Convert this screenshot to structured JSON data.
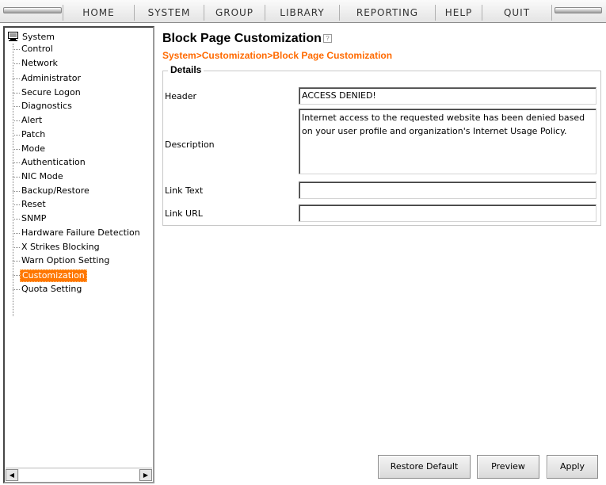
{
  "menu": {
    "items": [
      "HOME",
      "SYSTEM",
      "GROUP",
      "LIBRARY",
      "REPORTING",
      "HELP",
      "QUIT"
    ]
  },
  "sidebar": {
    "root_label": "System",
    "root_icon": "monitor-icon",
    "items": [
      {
        "label": "Control"
      },
      {
        "label": "Network"
      },
      {
        "label": "Administrator"
      },
      {
        "label": "Secure Logon"
      },
      {
        "label": "Diagnostics"
      },
      {
        "label": "Alert"
      },
      {
        "label": "Patch"
      },
      {
        "label": "Mode"
      },
      {
        "label": "Authentication"
      },
      {
        "label": "NIC Mode"
      },
      {
        "label": "Backup/Restore"
      },
      {
        "label": "Reset"
      },
      {
        "label": "SNMP"
      },
      {
        "label": "Hardware Failure Detection"
      },
      {
        "label": "X Strikes Blocking"
      },
      {
        "label": "Warn Option Setting"
      },
      {
        "label": "Customization",
        "selected": true
      },
      {
        "label": "Quota Setting"
      }
    ],
    "selected_color": "#ff7700",
    "scroll_left": "◀",
    "scroll_right": "▶"
  },
  "main": {
    "title": "Block Page Customization",
    "help_icon": "?",
    "breadcrumb": "System>Customization>Block Page Customization",
    "breadcrumb_color": "#ff6a00",
    "details_legend": "Details",
    "fields": {
      "header": {
        "label": "Header",
        "value": "ACCESS DENIED!"
      },
      "description": {
        "label": "Description",
        "value": "Internet access to the requested website has been denied based on your user profile and organization's Internet Usage Policy."
      },
      "link_text": {
        "label": "Link Text",
        "value": ""
      },
      "link_url": {
        "label": "Link URL",
        "value": ""
      }
    },
    "buttons": {
      "restore": "Restore Default",
      "preview": "Preview",
      "apply": "Apply"
    }
  }
}
